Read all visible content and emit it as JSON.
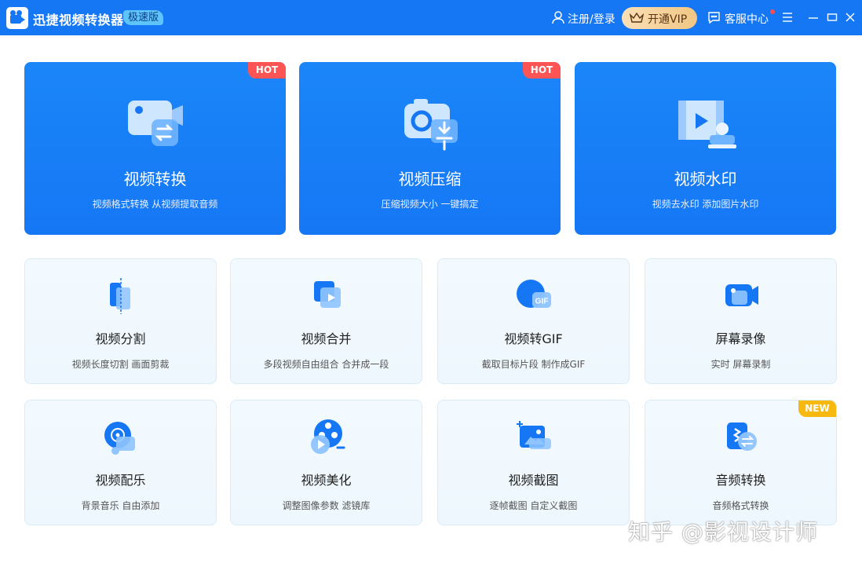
{
  "titlebar": {
    "app_title": "迅捷视频转换器",
    "edition": "极速版",
    "login": "注册/登录",
    "vip": "开通VIP",
    "service": "客服中心"
  },
  "big_cards": [
    {
      "title": "视频转换",
      "desc": "视频格式转换 从视频提取音频",
      "badge": "HOT"
    },
    {
      "title": "视频压缩",
      "desc": "压缩视频大小 一键搞定",
      "badge": "HOT"
    },
    {
      "title": "视频水印",
      "desc": "视频去水印 添加图片水印"
    }
  ],
  "small_cards": [
    {
      "title": "视频分割",
      "desc": "视频长度切割 画面剪裁"
    },
    {
      "title": "视频合并",
      "desc": "多段视频自由组合 合并成一段"
    },
    {
      "title": "视频转GIF",
      "desc": "截取目标片段 制作成GIF"
    },
    {
      "title": "屏幕录像",
      "desc": "实时 屏幕录制"
    },
    {
      "title": "视频配乐",
      "desc": "背景音乐 自由添加"
    },
    {
      "title": "视频美化",
      "desc": "调整图像参数 滤镜库"
    },
    {
      "title": "视频截图",
      "desc": "逐帧截图 自定义截图"
    },
    {
      "title": "音频转换",
      "desc": "音频格式转换",
      "badge": "NEW"
    }
  ],
  "gif_icon_text": "GIF",
  "watermark": "知乎 @影视设计师",
  "colors": {
    "primary": "#1677f5",
    "hot": "#ff5454",
    "new": "#f7b90f",
    "vip": "#f1c684"
  }
}
